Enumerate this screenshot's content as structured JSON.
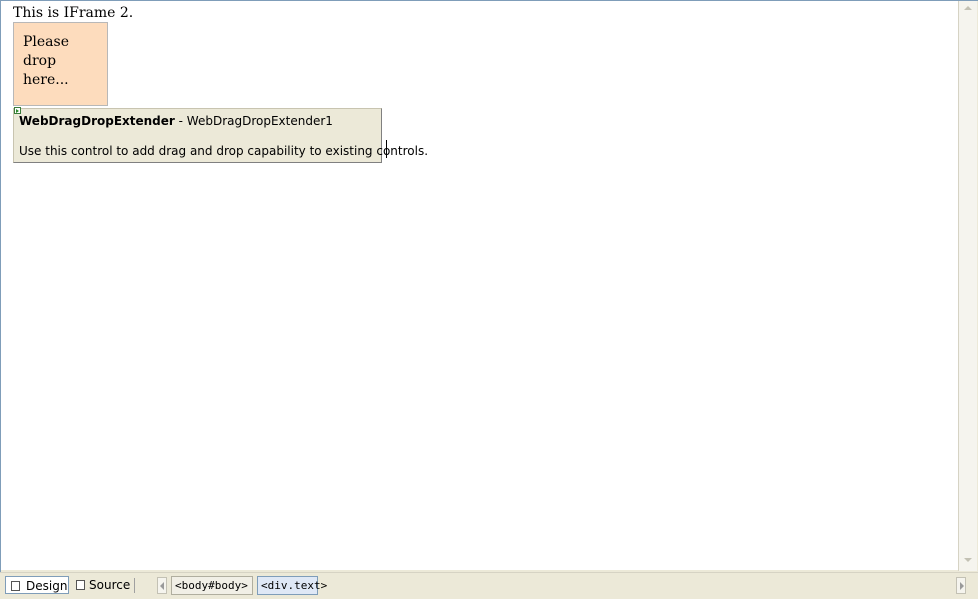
{
  "document": {
    "intro_text": "This is IFrame 2.",
    "drop_zone_text": "Please drop here..."
  },
  "extender": {
    "control_type": "WebDragDropExtender",
    "separator": " - ",
    "instance_name": "WebDragDropExtender1",
    "description": "Use this control to add drag and drop capability to existing controls."
  },
  "view_tabs": {
    "design_label": "Design",
    "source_label": "Source"
  },
  "breadcrumbs": [
    "<body#body>",
    "<div.text>"
  ],
  "colors": {
    "drop_zone_bg": "#fddcbd",
    "extender_bg": "#ece9d8",
    "selected_crumb_bg": "#dfe8f6"
  }
}
